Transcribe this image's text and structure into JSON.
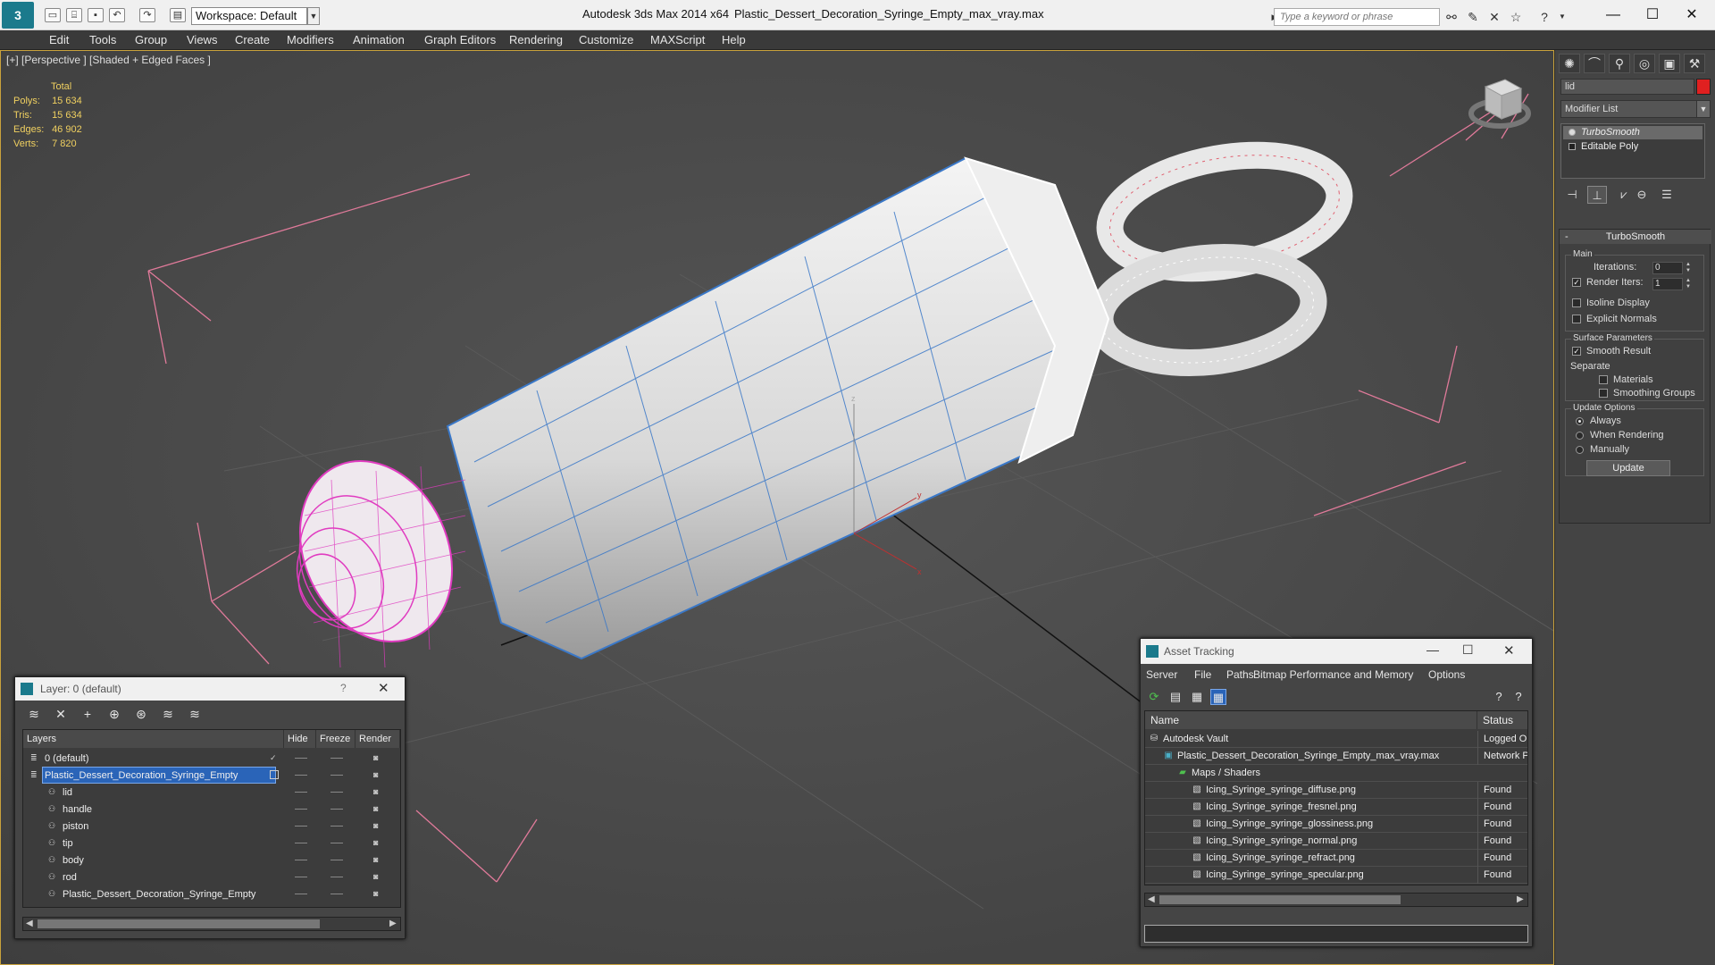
{
  "titlebar": {
    "workspace": "Workspace: Default",
    "app_title": "Autodesk 3ds Max  2014 x64",
    "file_title": "Plastic_Dessert_Decoration_Syringe_Empty_max_vray.max",
    "search_placeholder": "Type a keyword or phrase"
  },
  "menus": [
    "Edit",
    "Tools",
    "Group",
    "Views",
    "Create",
    "Modifiers",
    "Animation",
    "Graph Editors",
    "Rendering",
    "Customize",
    "MAXScript",
    "Help"
  ],
  "viewport": {
    "label": "[+] [Perspective ] [Shaded + Edged Faces ]",
    "stats": {
      "header": "Total",
      "rows": [
        {
          "label": "Polys:",
          "value": "15 634"
        },
        {
          "label": "Tris:",
          "value": "15 634"
        },
        {
          "label": "Edges:",
          "value": "46 902"
        },
        {
          "label": "Verts:",
          "value": "7 820"
        }
      ]
    }
  },
  "command_panel": {
    "object_name": "lid",
    "object_color": "#e02020",
    "modifier_list": "Modifier List",
    "stack": [
      {
        "label": "TurboSmooth",
        "selected": true
      },
      {
        "label": "Editable Poly",
        "selected": false
      }
    ],
    "turbosmooth": {
      "title": "TurboSmooth",
      "main_group": "Main",
      "iterations_label": "Iterations:",
      "iterations_value": "0",
      "render_iters_label": "Render Iters:",
      "render_iters_value": "1",
      "render_iters_checked": true,
      "isoline_label": "Isoline Display",
      "explicit_normals_label": "Explicit Normals",
      "surface_group": "Surface Parameters",
      "smooth_result_label": "Smooth Result",
      "separate_label": "Separate",
      "materials_label": "Materials",
      "smoothing_groups_label": "Smoothing Groups",
      "update_group": "Update Options",
      "always_label": "Always",
      "when_rendering_label": "When Rendering",
      "manually_label": "Manually",
      "update_button": "Update"
    }
  },
  "layer_dialog": {
    "title": "Layer: 0 (default)",
    "help": "?",
    "columns": [
      "Layers",
      "Hide",
      "Freeze",
      "Render"
    ],
    "rows": [
      {
        "name": "0 (default)",
        "indent": 0,
        "type": "layer",
        "selected": false
      },
      {
        "name": "Plastic_Dessert_Decoration_Syringe_Empty",
        "indent": 0,
        "type": "layer",
        "selected": true
      },
      {
        "name": "lid",
        "indent": 1,
        "type": "object",
        "selected": false
      },
      {
        "name": "handle",
        "indent": 1,
        "type": "object",
        "selected": false
      },
      {
        "name": "piston",
        "indent": 1,
        "type": "object",
        "selected": false
      },
      {
        "name": "tip",
        "indent": 1,
        "type": "object",
        "selected": false
      },
      {
        "name": "body",
        "indent": 1,
        "type": "object",
        "selected": false
      },
      {
        "name": "rod",
        "indent": 1,
        "type": "object",
        "selected": false
      },
      {
        "name": "Plastic_Dessert_Decoration_Syringe_Empty",
        "indent": 1,
        "type": "object",
        "selected": false
      }
    ]
  },
  "asset_dialog": {
    "title": "Asset Tracking",
    "menus": [
      "Server",
      "File",
      "Paths",
      "Bitmap Performance and Memory",
      "Options"
    ],
    "columns": [
      "Name",
      "Status"
    ],
    "rows": [
      {
        "name": "Autodesk Vault",
        "status": "Logged Ou",
        "indent": 0
      },
      {
        "name": "Plastic_Dessert_Decoration_Syringe_Empty_max_vray.max",
        "status": "Network P",
        "indent": 1
      },
      {
        "name": "Maps / Shaders",
        "status": "",
        "indent": 2
      },
      {
        "name": "Icing_Syringe_syringe_diffuse.png",
        "status": "Found",
        "indent": 3
      },
      {
        "name": "Icing_Syringe_syringe_fresnel.png",
        "status": "Found",
        "indent": 3
      },
      {
        "name": "Icing_Syringe_syringe_glossiness.png",
        "status": "Found",
        "indent": 3
      },
      {
        "name": "Icing_Syringe_syringe_normal.png",
        "status": "Found",
        "indent": 3
      },
      {
        "name": "Icing_Syringe_syringe_refract.png",
        "status": "Found",
        "indent": 3
      },
      {
        "name": "Icing_Syringe_syringe_specular.png",
        "status": "Found",
        "indent": 3
      }
    ]
  },
  "icons": {
    "app_logo": "3ds-max-logo-icon",
    "viewcube": "viewcube-icon"
  }
}
